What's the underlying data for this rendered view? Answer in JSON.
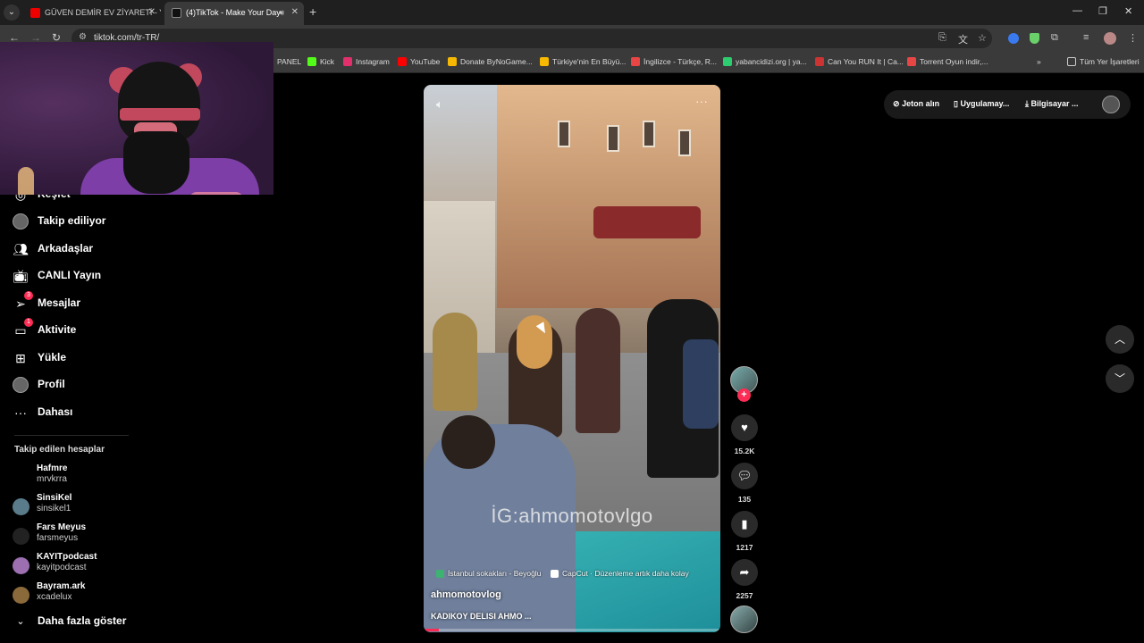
{
  "browser": {
    "tabs": [
      {
        "title": "GÜVEN DEMİR EV ZİYARETİ - Yo",
        "active": false
      },
      {
        "title": "(4)TikTok - Make Your Day",
        "active": true
      }
    ],
    "url": "tiktok.com/tr-TR/",
    "bookmarks": [
      {
        "label": "PANEL"
      },
      {
        "label": "Kick",
        "color": "#53fc18"
      },
      {
        "label": "Instagram",
        "color": "#e1306c"
      },
      {
        "label": "YouTube",
        "color": "#ff0000"
      },
      {
        "label": "Donate ByNoGame...",
        "color": "#f6b800"
      },
      {
        "label": "Türkiye'nin En Büyü...",
        "color": "#f6b800"
      },
      {
        "label": "İngilizce - Türkçe, R...",
        "color": "#e84545"
      },
      {
        "label": "yabancidizi.org | ya...",
        "color": "#2ecc71"
      },
      {
        "label": "Can You RUN It | Ca...",
        "color": "#cc3333"
      },
      {
        "label": "Torrent Oyun indir,...",
        "color": "#e84545"
      }
    ],
    "all_bookmarks_label": "Tüm Yer İşaretleri"
  },
  "sidebar": {
    "items": [
      {
        "label": "Keşfet",
        "icon": "compass-icon"
      },
      {
        "label": "Takip ediliyor",
        "icon": "following-avatar-icon"
      },
      {
        "label": "Arkadaşlar",
        "icon": "friends-icon"
      },
      {
        "label": "CANLI Yayın",
        "icon": "live-tv-icon"
      },
      {
        "label": "Mesajlar",
        "icon": "message-icon",
        "badge": "3"
      },
      {
        "label": "Aktivite",
        "icon": "activity-icon",
        "badge": "1"
      },
      {
        "label": "Yükle",
        "icon": "upload-plus-icon"
      },
      {
        "label": "Profil",
        "icon": "profile-avatar-icon"
      },
      {
        "label": "Dahası",
        "icon": "more-dots-icon"
      }
    ],
    "followed_title": "Takip edilen hesaplar",
    "accounts": [
      {
        "name": "Hafmre",
        "handle": "mrvkrra"
      },
      {
        "name": "SinsiKel",
        "handle": "sinsikel1"
      },
      {
        "name": "Fars Meyus",
        "handle": "farsmeyus"
      },
      {
        "name": "KAYITpodcast",
        "handle": "kayitpodcast"
      },
      {
        "name": "Bayram.ark",
        "handle": "xcadelux"
      }
    ],
    "show_more": "Daha fazla göster"
  },
  "video": {
    "watermark": "İG:ahmomotovlgo",
    "location_tag": "İstanbul sokakları - Beyoğlu",
    "capcut_tag": "CapCut · Düzenleme artık daha kolay",
    "author": "ahmomotovlog",
    "caption": "KADIKOY DELISI AHMO ...",
    "progress": 0.05
  },
  "actions": {
    "likes": "15.2K",
    "comments": "135",
    "saves": "1217",
    "shares": "2257"
  },
  "top_pill": {
    "coins": "Jeton alın",
    "app": "Uygulamay...",
    "desktop": "Bilgisayar ..."
  },
  "colors": {
    "accent": "#fe2c55",
    "background": "#000000"
  }
}
